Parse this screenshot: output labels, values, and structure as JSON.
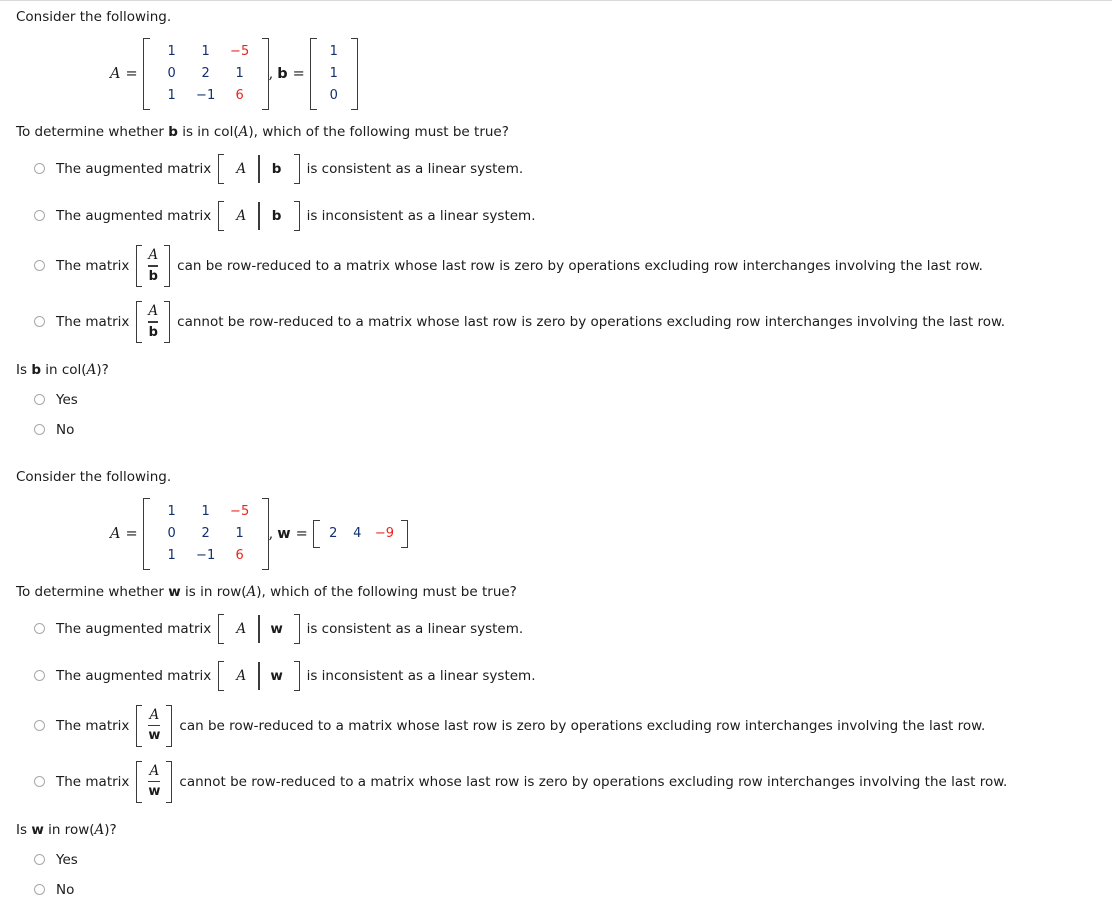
{
  "problems": [
    {
      "prompt": "Consider the following.",
      "matrix_label": "A",
      "equals": "=",
      "matrix_rows": [
        [
          {
            "t": "1",
            "c": "navy"
          },
          {
            "t": "1",
            "c": "navy"
          },
          {
            "t": "−5",
            "c": "red"
          }
        ],
        [
          {
            "t": "0",
            "c": "navy"
          },
          {
            "t": "2",
            "c": "navy"
          },
          {
            "t": "1",
            "c": "navy"
          }
        ],
        [
          {
            "t": "1",
            "c": "navy"
          },
          {
            "t": "−1",
            "c": "navy"
          },
          {
            "t": "6",
            "c": "red"
          }
        ]
      ],
      "comma": ",",
      "vector_label": "b",
      "vector_kind": "column",
      "vector_values": [
        {
          "t": "1",
          "c": "navy"
        },
        {
          "t": "1",
          "c": "navy"
        },
        {
          "t": "0",
          "c": "navy"
        }
      ],
      "question_pre": "To determine whether ",
      "question_var": "b",
      "question_post": " is in col(",
      "question_mat": "A",
      "question_end": "), which of the following must be true?",
      "options": [
        {
          "kind": "augmented",
          "pre": "The augmented matrix",
          "left_sym": "A",
          "right_sym": "b",
          "post": "is consistent as a linear system."
        },
        {
          "kind": "augmented",
          "pre": "The augmented matrix",
          "left_sym": "A",
          "right_sym": "b",
          "post": "is inconsistent as a linear system."
        },
        {
          "kind": "stacked",
          "pre": "The matrix",
          "top_sym": "A",
          "bottom_sym": "b",
          "post": "can be row-reduced to a matrix whose last row is zero by operations excluding row interchanges involving the last row."
        },
        {
          "kind": "stacked",
          "pre": "The matrix",
          "top_sym": "A",
          "bottom_sym": "b",
          "post": "cannot be row-reduced to a matrix whose last row is zero by operations excluding row interchanges involving the last row."
        }
      ],
      "sub_pre": "Is ",
      "sub_var": "b",
      "sub_mid": " in col(",
      "sub_mat": "A",
      "sub_end": ")?",
      "yesno": [
        "Yes",
        "No"
      ]
    },
    {
      "prompt": "Consider the following.",
      "matrix_label": "A",
      "equals": "=",
      "matrix_rows": [
        [
          {
            "t": "1",
            "c": "navy"
          },
          {
            "t": "1",
            "c": "navy"
          },
          {
            "t": "−5",
            "c": "red"
          }
        ],
        [
          {
            "t": "0",
            "c": "navy"
          },
          {
            "t": "2",
            "c": "navy"
          },
          {
            "t": "1",
            "c": "navy"
          }
        ],
        [
          {
            "t": "1",
            "c": "navy"
          },
          {
            "t": "−1",
            "c": "navy"
          },
          {
            "t": "6",
            "c": "red"
          }
        ]
      ],
      "comma": ",",
      "vector_label": "w",
      "vector_kind": "row",
      "vector_values": [
        {
          "t": "2",
          "c": "navy"
        },
        {
          "t": "4",
          "c": "navy"
        },
        {
          "t": "−9",
          "c": "red"
        }
      ],
      "question_pre": "To determine whether ",
      "question_var": "w",
      "question_post": " is in row(",
      "question_mat": "A",
      "question_end": "), which of the following must be true?",
      "options": [
        {
          "kind": "augmented",
          "pre": "The augmented matrix",
          "left_sym": "A",
          "right_sym": "w",
          "post": "is consistent as a linear system."
        },
        {
          "kind": "augmented",
          "pre": "The augmented matrix",
          "left_sym": "A",
          "right_sym": "w",
          "post": "is inconsistent as a linear system."
        },
        {
          "kind": "stacked",
          "pre": "The matrix",
          "top_sym": "A",
          "bottom_sym": "w",
          "post": "can be row-reduced to a matrix whose last row is zero by operations excluding row interchanges involving the last row."
        },
        {
          "kind": "stacked",
          "pre": "The matrix",
          "top_sym": "A",
          "bottom_sym": "w",
          "post": "cannot be row-reduced to a matrix whose last row is zero by operations excluding row interchanges involving the last row."
        }
      ],
      "sub_pre": "Is ",
      "sub_var": "w",
      "sub_mid": " in row(",
      "sub_mat": "A",
      "sub_end": ")?",
      "yesno": [
        "Yes",
        "No"
      ]
    }
  ],
  "colors": {
    "navy": "#12306e",
    "red": "#e8251f",
    "text": "#1b1b1b",
    "radio_border": "#a8a8a8",
    "bracket": "#3b3b3b"
  }
}
